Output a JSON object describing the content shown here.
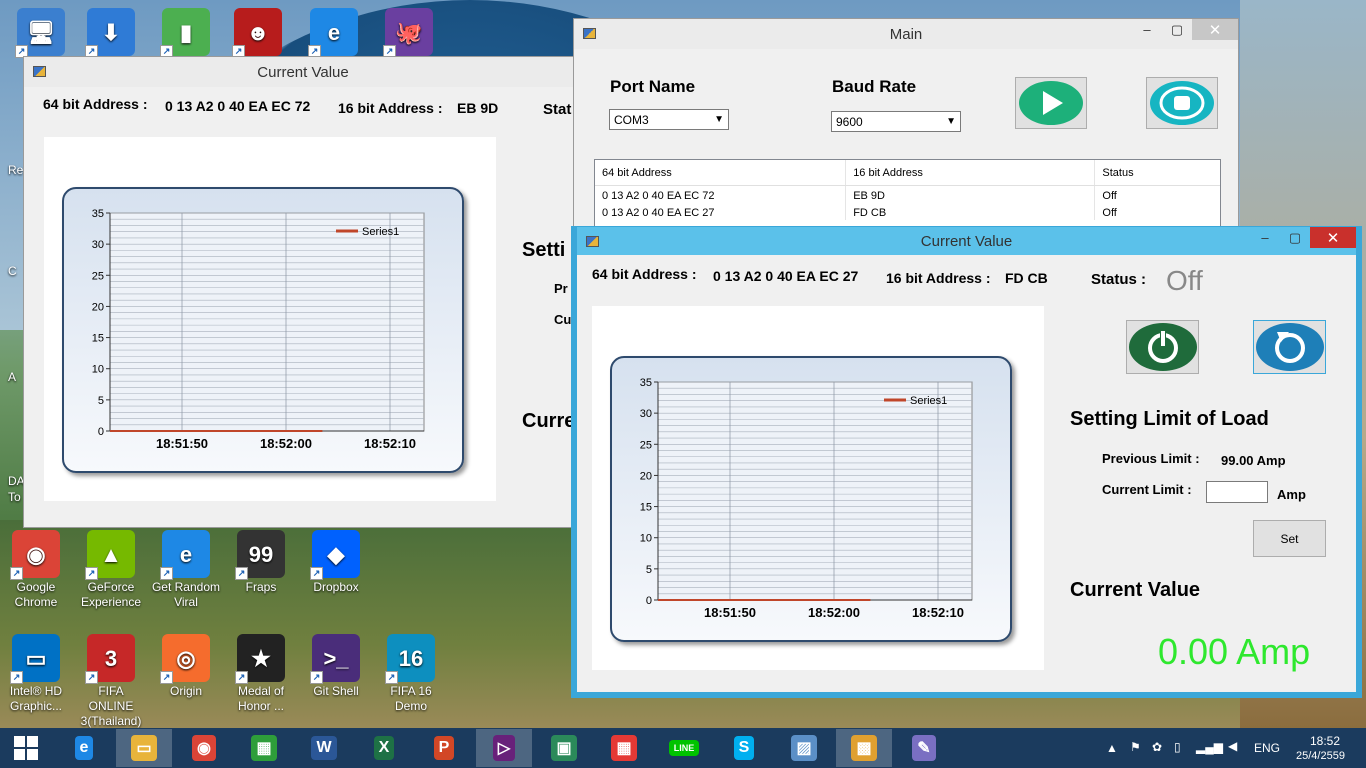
{
  "desktop": {
    "icons_top": [
      {
        "name": "this-pc",
        "glyph": "🖥",
        "color": "#3b7fcf"
      },
      {
        "name": "setup",
        "glyph": "⬇",
        "color": "#2f7bd6"
      },
      {
        "name": "notebook",
        "glyph": "▮",
        "color": "#4caf50"
      },
      {
        "name": "hacker",
        "glyph": "☻",
        "color": "#b71c1c"
      },
      {
        "name": "ie",
        "glyph": "e",
        "color": "#1e88e5"
      },
      {
        "name": "github",
        "glyph": "🐙",
        "color": "#6a3fa0"
      }
    ],
    "left_partials": [
      "Re",
      "C",
      "A",
      "DA",
      "To"
    ],
    "row1": [
      {
        "label": "Google Chrome",
        "glyph": "◉",
        "color": "#db4437"
      },
      {
        "label": "GeForce Experience",
        "glyph": "▲",
        "color": "#76b900"
      },
      {
        "label": "Get Random Viral",
        "glyph": "e",
        "color": "#1e88e5"
      },
      {
        "label": "Fraps",
        "glyph": "99",
        "color": "#333"
      },
      {
        "label": "Dropbox",
        "glyph": "◆",
        "color": "#0061fe"
      }
    ],
    "row2": [
      {
        "label": "Intel® HD Graphic...",
        "glyph": "▭",
        "color": "#0071c5"
      },
      {
        "label": "FIFA ONLINE 3(Thailand)",
        "glyph": "3",
        "color": "#c62828"
      },
      {
        "label": "Origin",
        "glyph": "◎",
        "color": "#f56c2d"
      },
      {
        "label": "Medal of Honor ...",
        "glyph": "★",
        "color": "#222"
      },
      {
        "label": "Git Shell",
        "glyph": ">_",
        "color": "#4a2d7a"
      },
      {
        "label": "FIFA 16 Demo",
        "glyph": "16",
        "color": "#0d8fbf"
      }
    ]
  },
  "back_window": {
    "title": "Current Value",
    "addr64_label": "64 bit Address :",
    "addr64_value": "0 13 A2 0 40 EA EC 72",
    "addr16_label": "16 bit Address :",
    "addr16_value": "EB 9D",
    "status_partial": "Stat",
    "setting_partial": "Setti",
    "prev_partial": "Pr",
    "cur_partial": "Cu",
    "curval_partial": "Curre"
  },
  "main_window": {
    "title": "Main",
    "port_label": "Port Name",
    "baud_label": "Baud Rate",
    "port_value": "COM3",
    "baud_value": "9600",
    "columns": [
      "64 bit Address",
      "16 bit Address",
      "Status"
    ],
    "rows": [
      [
        "0 13 A2 0 40 EA EC 72",
        "EB 9D",
        "Off"
      ],
      [
        "0 13 A2 0 40 EA EC 27",
        "FD CB",
        "Off"
      ]
    ]
  },
  "front_window": {
    "title": "Current Value",
    "addr64_label": "64 bit Address :",
    "addr64_value": "0 13 A2 0 40 EA EC 27",
    "addr16_label": "16 bit Address :",
    "addr16_value": "FD CB",
    "status_label": "Status :",
    "status_value": "Off",
    "setting_title": "Setting Limit of Load",
    "prev_limit_label": "Previous Limit :",
    "prev_limit_value": "99.00 Amp",
    "cur_limit_label": "Current Limit :",
    "cur_limit_value": "",
    "cur_limit_unit": "Amp",
    "set_label": "Set",
    "current_value_title": "Current Value",
    "current_value": "0.00 Amp",
    "current_value_color": "#2ee82e"
  },
  "chart_data": [
    {
      "type": "line",
      "y_ticks": [
        0,
        5,
        10,
        15,
        20,
        25,
        30,
        35
      ],
      "x_ticks": [
        "18:51:50",
        "18:52:00",
        "18:52:10"
      ],
      "ylim": [
        0,
        35
      ],
      "grid": true,
      "legend": "top-right",
      "series": [
        {
          "name": "Series1",
          "color": "#c0462a",
          "x": [
            "18:51:50",
            "18:52:00",
            "18:52:10"
          ],
          "values": [
            0,
            0,
            0
          ]
        }
      ]
    },
    {
      "type": "line",
      "y_ticks": [
        0,
        5,
        10,
        15,
        20,
        25,
        30,
        35
      ],
      "x_ticks": [
        "18:51:50",
        "18:52:00",
        "18:52:10"
      ],
      "ylim": [
        0,
        35
      ],
      "grid": true,
      "legend": "top-right",
      "series": [
        {
          "name": "Series1",
          "color": "#c0462a",
          "x": [
            "18:51:50",
            "18:52:00",
            "18:52:10"
          ],
          "values": [
            0,
            0,
            0
          ]
        }
      ]
    }
  ],
  "taskbar": {
    "lang": "ENG",
    "time": "18:52",
    "date": "25/4/2559",
    "apps": [
      {
        "name": "ie",
        "glyph": "e",
        "color": "#1e88e5"
      },
      {
        "name": "explorer",
        "glyph": "▭",
        "color": "#e8b43b"
      },
      {
        "name": "chrome",
        "glyph": "◉",
        "color": "#db4437"
      },
      {
        "name": "store",
        "glyph": "▦",
        "color": "#2e9e3a"
      },
      {
        "name": "word",
        "glyph": "W",
        "color": "#2b5797"
      },
      {
        "name": "excel",
        "glyph": "X",
        "color": "#1e7145"
      },
      {
        "name": "powerpoint",
        "glyph": "P",
        "color": "#d24726"
      },
      {
        "name": "visual-studio",
        "glyph": "▷",
        "color": "#68217a"
      },
      {
        "name": "photo",
        "glyph": "▣",
        "color": "#2b8a5a"
      },
      {
        "name": "apps",
        "glyph": "▦",
        "color": "#e53935"
      },
      {
        "name": "line",
        "glyph": "LINE",
        "color": "#00c300"
      },
      {
        "name": "skype",
        "glyph": "S",
        "color": "#00aff0"
      },
      {
        "name": "image-viewer",
        "glyph": "▨",
        "color": "#5b8fc7"
      },
      {
        "name": "winforms-app",
        "glyph": "▩",
        "color": "#e0a030"
      },
      {
        "name": "paint",
        "glyph": "✎",
        "color": "#7a6fc2"
      }
    ]
  }
}
